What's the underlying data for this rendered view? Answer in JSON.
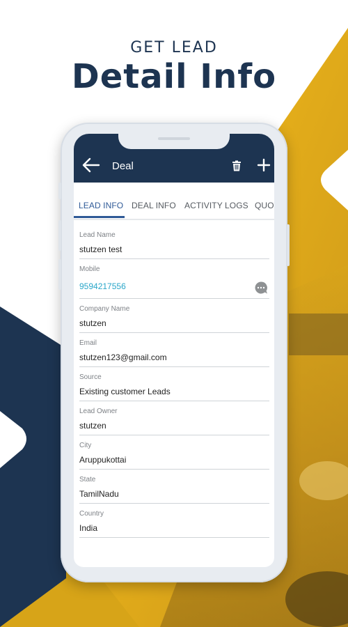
{
  "promo": {
    "subtitle": "GET LEAD",
    "title": "Detail Info"
  },
  "colors": {
    "navy": "#1d3451",
    "yellow": "#f5b915",
    "accent_blue": "#2f5a97",
    "link": "#29a6c9"
  },
  "app_bar": {
    "back_icon": "arrow-left-icon",
    "title": "Deal",
    "delete_icon": "trash-icon",
    "add_icon": "plus-icon"
  },
  "tabs": [
    {
      "label": "LEAD INFO",
      "active": true
    },
    {
      "label": "DEAL INFO",
      "active": false
    },
    {
      "label": "ACTIVITY LOGS",
      "active": false
    },
    {
      "label": "QUOT",
      "active": false
    }
  ],
  "fields": [
    {
      "label": "Lead Name",
      "value": "stutzen test"
    },
    {
      "label": "Mobile",
      "value": "9594217556",
      "action_icon": "chat-bubble-icon"
    },
    {
      "label": "Company Name",
      "value": "stutzen"
    },
    {
      "label": "Email",
      "value": "stutzen123@gmail.com"
    },
    {
      "label": "Source",
      "value": "Existing customer Leads"
    },
    {
      "label": "Lead Owner",
      "value": "stutzen"
    },
    {
      "label": "City",
      "value": "Aruppukottai"
    },
    {
      "label": "State",
      "value": "TamilNadu"
    },
    {
      "label": "Country",
      "value": "India"
    }
  ]
}
